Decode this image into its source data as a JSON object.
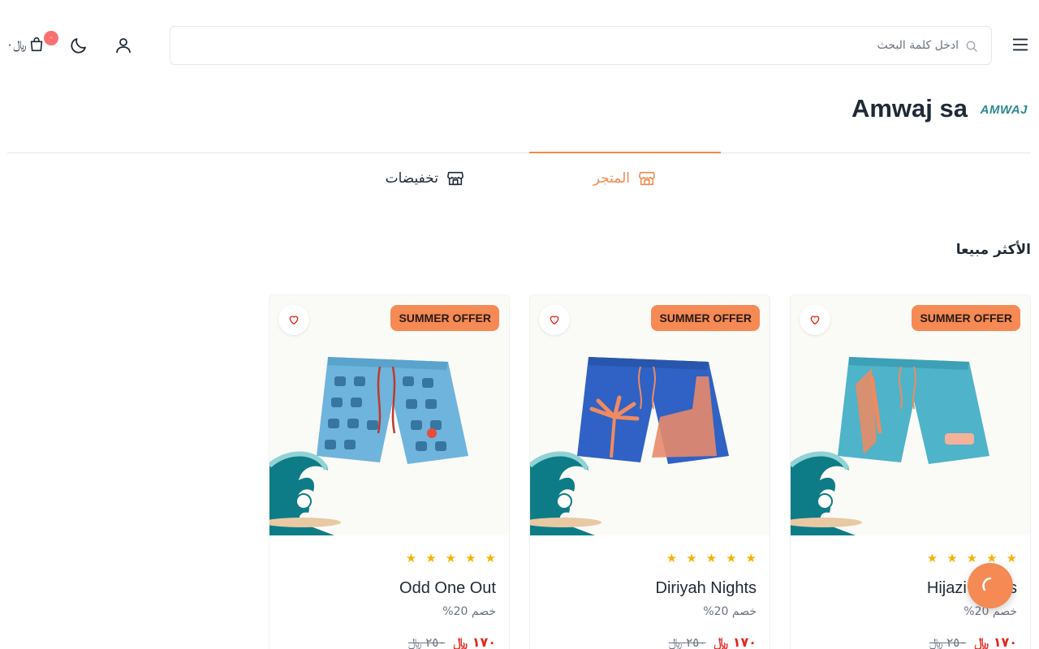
{
  "header": {
    "search_placeholder": "ادخل كلمة البحث",
    "cart_amount": "٠",
    "cart_currency": "﷼",
    "cart_count": "٠",
    "icons": {
      "menu": "menu-icon",
      "search": "search-icon",
      "user": "user-icon",
      "theme": "moon-icon",
      "cart": "cart-icon"
    }
  },
  "store": {
    "name": "Amwaj sa",
    "logo_text": "AMWAJ"
  },
  "tabs": [
    {
      "label": "المتجر",
      "active": true
    },
    {
      "label": "تخفيضات",
      "active": false
    }
  ],
  "section": {
    "title": "الأكثر مبيعا"
  },
  "products": [
    {
      "name": "Hijazi Drives",
      "badge": "SUMMER OFFER",
      "rating": 5,
      "discount": "خصم 20%",
      "price_new": "١٧٠",
      "price_old": "٢٥٠",
      "currency": "﷼",
      "shorts_color": "#4fb3c9"
    },
    {
      "name": "Diriyah Nights",
      "badge": "SUMMER OFFER",
      "rating": 5,
      "discount": "خصم 20%",
      "price_new": "١٧٠",
      "price_old": "٢٥٠",
      "currency": "﷼",
      "shorts_color": "#2f62c4"
    },
    {
      "name": "Odd One Out",
      "badge": "SUMMER OFFER",
      "rating": 5,
      "discount": "خصم 20%",
      "price_new": "١٧٠",
      "price_old": "٢٥٠",
      "currency": "﷼",
      "shorts_color": "#6fb4dc"
    }
  ],
  "colors": {
    "accent": "#f08a4b",
    "badge": "#f58a55",
    "price": "#e1261c",
    "star": "#f5b301",
    "wave": "#0e7c86"
  }
}
